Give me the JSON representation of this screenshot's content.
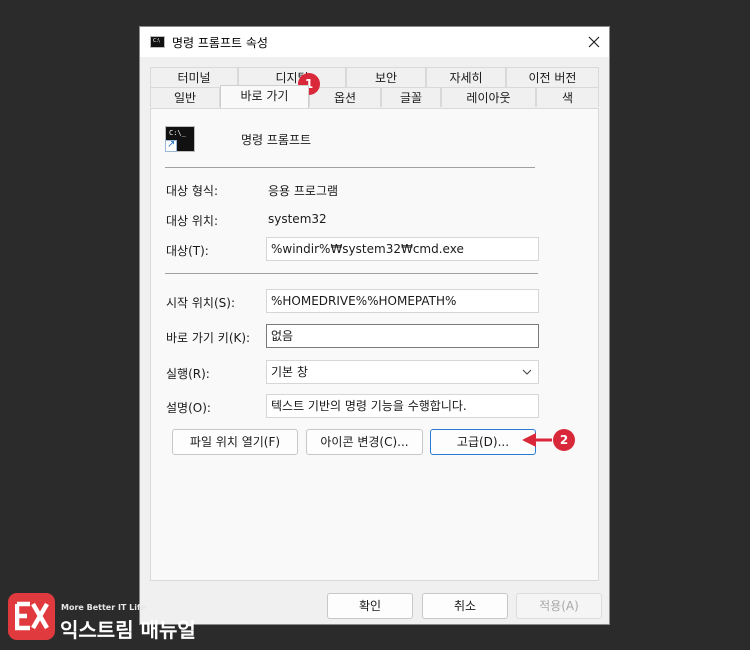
{
  "window": {
    "title": "명령 프롬프트 속성",
    "close_glyph": "✕"
  },
  "tabs": {
    "row_back": [
      "터미널",
      "디지털",
      "보안",
      "자세히",
      "이전 버전"
    ],
    "row_front": [
      "일반",
      "바로 가기",
      "옵션",
      "글꼴",
      "레이아웃",
      "색"
    ],
    "active": "바로 가기"
  },
  "app": {
    "icon": "cmd-icon",
    "icon_prompt": "C:\\_",
    "name": "명령 프롬프트"
  },
  "fields": {
    "target_type_label": "대상 형식:",
    "target_type_value": "응용 프로그램",
    "target_location_label": "대상 위치:",
    "target_location_value": "system32",
    "target_label": "대상(T):",
    "target_value": "%windir%₩system32₩cmd.exe",
    "start_in_label": "시작 위치(S):",
    "start_in_value": "%HOMEDRIVE%%HOMEPATH%",
    "shortcut_key_label": "바로 가기 키(K):",
    "shortcut_key_value": "없음",
    "run_label": "실행(R):",
    "run_value": "기본 창",
    "comment_label": "설명(O):",
    "comment_value": "텍스트 기반의 명령 기능을 수행합니다."
  },
  "buttons": {
    "open_file_location": "파일 위치 열기(F)",
    "change_icon": "아이콘 변경(C)...",
    "advanced": "고급(D)...",
    "ok": "확인",
    "cancel": "취소",
    "apply": "적용(A)"
  },
  "annotations": {
    "badge1": "1",
    "badge2": "2",
    "color": "#d9283a"
  },
  "brand": {
    "tagline": "More Better IT Life",
    "name": "익스트림 매뉴얼"
  }
}
